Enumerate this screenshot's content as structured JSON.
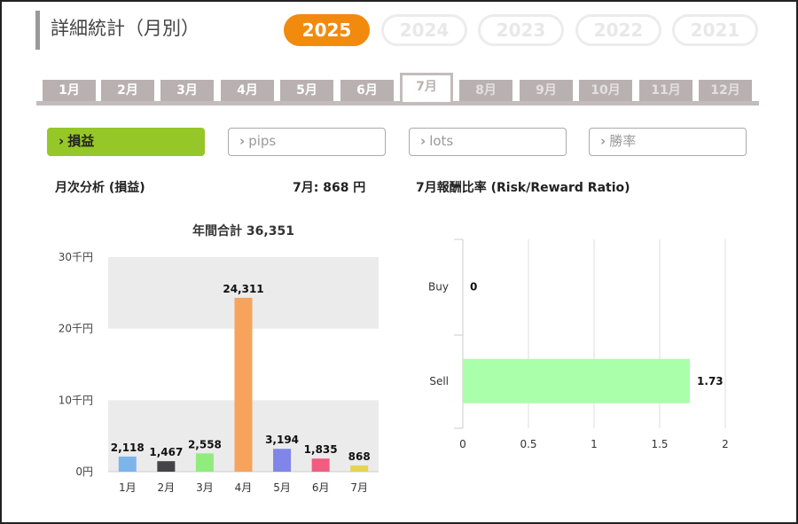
{
  "header": {
    "title": "詳細統計（月別）"
  },
  "years": [
    {
      "label": "2025",
      "active": true
    },
    {
      "label": "2024",
      "active": false
    },
    {
      "label": "2023",
      "active": false
    },
    {
      "label": "2022",
      "active": false
    },
    {
      "label": "2021",
      "active": false
    }
  ],
  "months": [
    "1月",
    "2月",
    "3月",
    "4月",
    "5月",
    "6月",
    "7月",
    "8月",
    "9月",
    "10月",
    "11月",
    "12月"
  ],
  "active_month": "7月",
  "metrics": [
    {
      "label": "損益",
      "active": true
    },
    {
      "label": "pips",
      "active": false
    },
    {
      "label": "lots",
      "active": false
    },
    {
      "label": "勝率",
      "active": false
    }
  ],
  "analysis": {
    "title": "月次分析 (損益)",
    "month_value": "7月:  868 円"
  },
  "rr": {
    "title": "7月報酬比率 (Risk/Reward Ratio)"
  },
  "chart_data": [
    {
      "type": "bar",
      "title": "年間合計 36,351",
      "categories": [
        "1月",
        "2月",
        "3月",
        "4月",
        "5月",
        "6月",
        "7月"
      ],
      "values": [
        2118,
        1467,
        2558,
        24311,
        3194,
        1835,
        868
      ],
      "value_labels": [
        "2,118",
        "1,467",
        "2,558",
        "24,311",
        "3,194",
        "1,835",
        "868"
      ],
      "colors": [
        "#7cb5ec",
        "#434348",
        "#90ed7d",
        "#f7a35c",
        "#8085e9",
        "#f15c80",
        "#e4d354"
      ],
      "ylim": [
        0,
        30000
      ],
      "yticks": [
        0,
        10000,
        20000,
        30000
      ],
      "ytick_labels": [
        "0円",
        "10千円",
        "20千円",
        "30千円"
      ],
      "grid": "alternating bands"
    },
    {
      "type": "bar",
      "orientation": "horizontal",
      "categories": [
        "Buy",
        "Sell"
      ],
      "values": [
        0,
        1.73
      ],
      "value_labels": [
        "0",
        "1.73"
      ],
      "color": "#aaffaa",
      "xlim": [
        0,
        2
      ],
      "xticks": [
        0,
        0.5,
        1,
        1.5,
        2
      ],
      "xtick_labels": [
        "0",
        "0.5",
        "1",
        "1.5",
        "2"
      ],
      "grid": "vertical lines"
    }
  ]
}
